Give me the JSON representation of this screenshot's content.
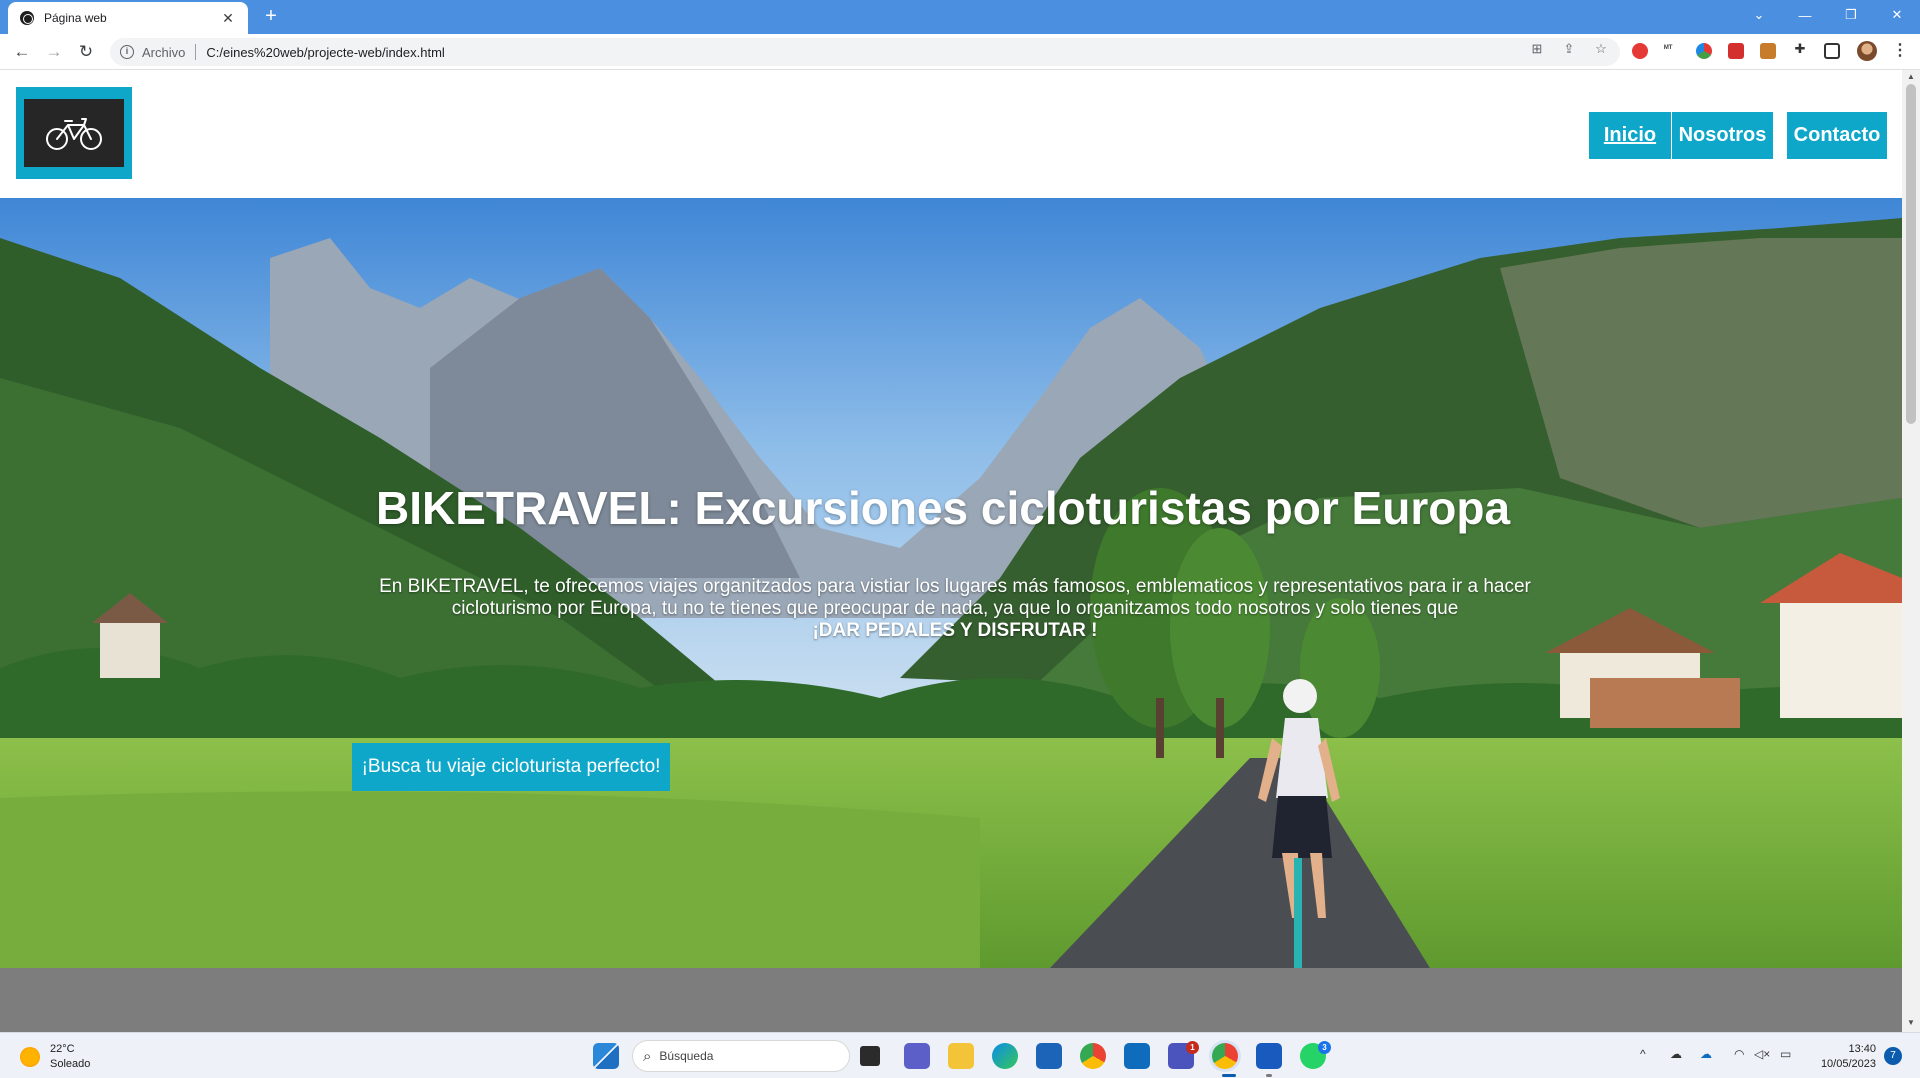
{
  "browser": {
    "tab_title": "Página web",
    "new_tab_label": "+",
    "address_scheme": "Archivo",
    "address_url": "C:/eines%20web/projecte-web/index.html",
    "window_controls": {
      "chevron": "⌄",
      "minimize": "—",
      "restore": "❐",
      "close": "✕"
    },
    "extension_colors": [
      "#e53935",
      "#444444",
      "#8e24aa",
      "#d32f2f",
      "#c77c2b",
      "#333333"
    ]
  },
  "site": {
    "nav": [
      {
        "label": "Inicio",
        "active": true
      },
      {
        "label": "Nosotros",
        "active": false
      },
      {
        "label": "Contacto",
        "active": false
      }
    ],
    "hero": {
      "title": "BIKETRAVEL: Excursiones cicloturistas por Europa",
      "text": "En BIKETRAVEL, te ofrecemos viajes organitzados para vistiar los lugares más famosos, emblematicos y representativos para ir a hacer cicloturismo por Europa, tu no te tienes que preocupar de nada, ya que lo organitzamos todo nosotros y solo tienes que",
      "text_strong": "¡DAR PEDALES Y DISFRUTAR !",
      "cta_label": "¡Busca tu viaje cicloturista perfecto!"
    },
    "colors": {
      "accent": "#0ea7c9",
      "logo_bg": "#262626",
      "band": "#7d7d7d"
    }
  },
  "taskbar": {
    "weather_temp": "22°C",
    "weather_desc": "Soleado",
    "search_placeholder": "Búsqueda",
    "time": "13:40",
    "date": "10/05/2023",
    "notification_count": "7",
    "teams_badge": "1",
    "whatsapp_badge": "3",
    "tray_chevron": "^"
  }
}
